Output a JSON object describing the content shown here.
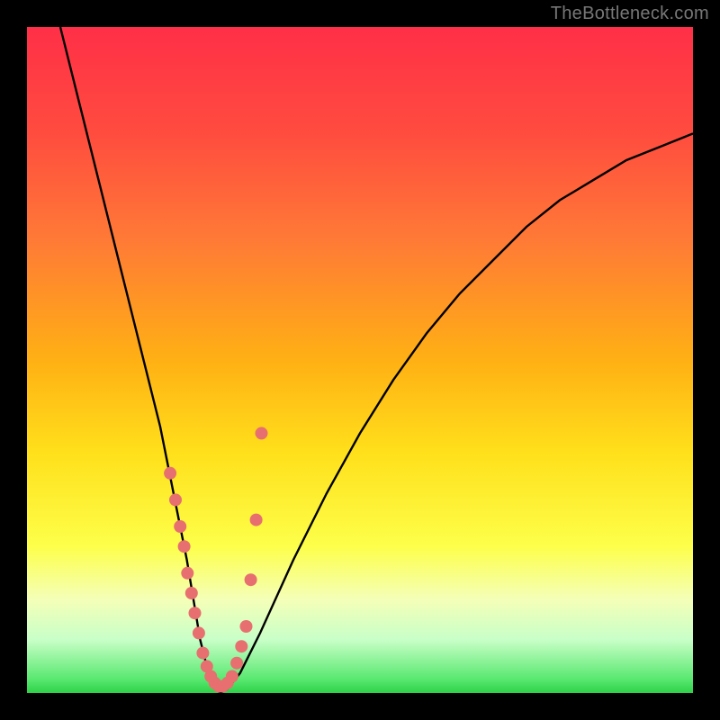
{
  "watermark": "TheBottleneck.com",
  "chart_data": {
    "type": "line",
    "title": "",
    "xlabel": "",
    "ylabel": "",
    "xlim": [
      0,
      100
    ],
    "ylim": [
      0,
      100
    ],
    "curve": {
      "name": "bottleneck-curve",
      "x": [
        5,
        8,
        11,
        14,
        17,
        20,
        22,
        24,
        25,
        26,
        27,
        28,
        29,
        30,
        32,
        35,
        40,
        45,
        50,
        55,
        60,
        65,
        70,
        75,
        80,
        85,
        90,
        95,
        100
      ],
      "y": [
        100,
        88,
        76,
        64,
        52,
        40,
        30,
        20,
        14,
        8,
        4,
        1,
        0,
        0.5,
        3,
        9,
        20,
        30,
        39,
        47,
        54,
        60,
        65,
        70,
        74,
        77,
        80,
        82,
        84
      ]
    },
    "points": {
      "name": "sample-points",
      "color": "#e86f6f",
      "x": [
        21.5,
        22.3,
        23.0,
        23.6,
        24.1,
        24.7,
        25.2,
        25.8,
        26.4,
        27.0,
        27.6,
        28.2,
        28.8,
        29.4,
        30.1,
        30.8,
        31.5,
        32.2,
        32.9,
        33.6,
        34.4,
        35.2
      ],
      "y": [
        33,
        29,
        25,
        22,
        18,
        15,
        12,
        9,
        6,
        4,
        2.5,
        1.5,
        1,
        1,
        1.5,
        2.5,
        4.5,
        7,
        10,
        17,
        26,
        39
      ]
    }
  }
}
